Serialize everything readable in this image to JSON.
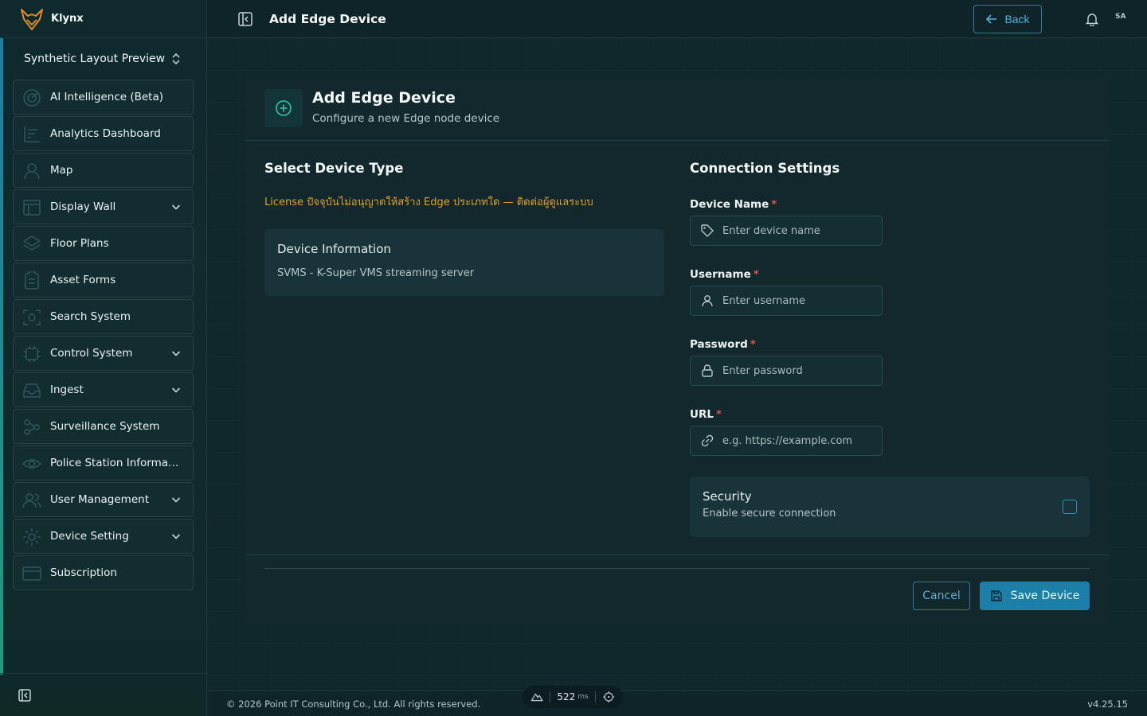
{
  "brand": {
    "name": "Klynx"
  },
  "workspace": {
    "name": "Synthetic Layout Preview"
  },
  "nav": {
    "items": [
      {
        "label": "AI Intelligence (Beta)",
        "icon": "radar-icon",
        "expandable": false
      },
      {
        "label": "Analytics Dashboard",
        "icon": "chart-icon",
        "expandable": false
      },
      {
        "label": "Map",
        "icon": "user-pin-icon",
        "expandable": false
      },
      {
        "label": "Display Wall",
        "icon": "layout-icon",
        "expandable": true
      },
      {
        "label": "Floor Plans",
        "icon": "layers-icon",
        "expandable": false
      },
      {
        "label": "Asset Forms",
        "icon": "clipboard-icon",
        "expandable": false
      },
      {
        "label": "Search System",
        "icon": "scan-search-icon",
        "expandable": false
      },
      {
        "label": "Control System",
        "icon": "cpu-icon",
        "expandable": true
      },
      {
        "label": "Ingest",
        "icon": "inbox-icon",
        "expandable": true
      },
      {
        "label": "Surveillance System",
        "icon": "network-icon",
        "expandable": false
      },
      {
        "label": "Police Station Informati...",
        "icon": "eye-icon",
        "expandable": false
      },
      {
        "label": "User Management",
        "icon": "users-icon",
        "expandable": true
      },
      {
        "label": "Device Setting",
        "icon": "gear-icon",
        "expandable": true
      },
      {
        "label": "Subscription",
        "icon": "card-icon",
        "expandable": false
      }
    ]
  },
  "header": {
    "title": "Add Edge Device",
    "back_label": "Back",
    "avatar_initials": "SA"
  },
  "card": {
    "title": "Add Edge Device",
    "subtitle": "Configure a new Edge node device"
  },
  "device_type": {
    "title": "Select Device Type",
    "license_note": "License ปัจจุบันไม่อนุญาตให้สร้าง Edge ประเภทใด — ติดต่อผู้ดูแลระบบ",
    "info_title": "Device Information",
    "info_text": "SVMS - K-Super VMS streaming server"
  },
  "connection": {
    "title": "Connection Settings",
    "fields": {
      "device_name": {
        "label": "Device Name",
        "required_mark": "*",
        "placeholder": "Enter device name",
        "value": ""
      },
      "username": {
        "label": "Username",
        "required_mark": "*",
        "placeholder": "Enter username",
        "value": ""
      },
      "password": {
        "label": "Password",
        "required_mark": "*",
        "placeholder": "Enter password",
        "value": ""
      },
      "url": {
        "label": "URL",
        "required_mark": "*",
        "placeholder": "e.g. https://example.com",
        "value": ""
      }
    },
    "security": {
      "title": "Security",
      "text": "Enable secure connection",
      "checked": false
    }
  },
  "actions": {
    "cancel_label": "Cancel",
    "save_label": "Save Device"
  },
  "footer": {
    "copyright": "© 2026 Point IT Consulting Co., Ltd. All rights reserved.",
    "version": "v4.25.15"
  },
  "perf": {
    "value": "522",
    "unit": "ms"
  },
  "colors": {
    "accent": "#1c7fa8",
    "accent_text": "#4fb3db",
    "warning": "#e0a326",
    "required": "#e45050",
    "success": "#2fb899"
  }
}
